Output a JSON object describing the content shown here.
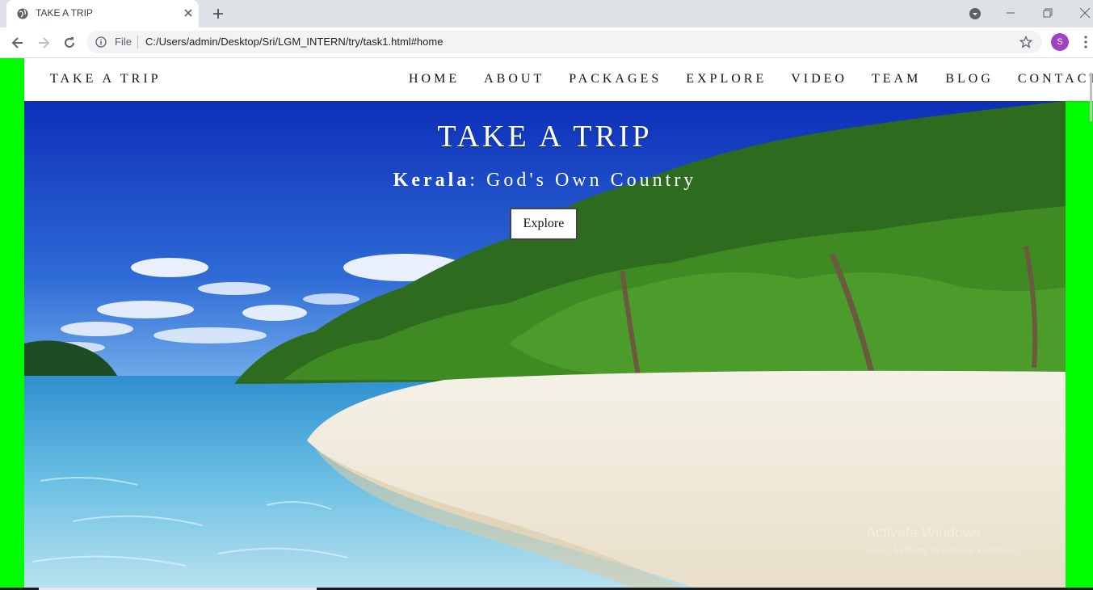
{
  "browser": {
    "tab_title": "TAKE A TRIP",
    "file_label": "File",
    "url": "C:/Users/admin/Desktop/Sri/LGM_INTERN/try/task1.html#home",
    "profile_initial": "S"
  },
  "site": {
    "brand": "TAKE A TRIP",
    "menu": [
      "HOME",
      "ABOUT",
      "PACKAGES",
      "EXPLORE",
      "VIDEO",
      "TEAM",
      "BLOG",
      "CONTACT"
    ]
  },
  "hero": {
    "title": "TAKE A TRIP",
    "subtitle_bold": "Kerala",
    "subtitle_rest": ": God's Own Country",
    "button_label": "Explore"
  },
  "watermark": {
    "line1": "Activate Windows",
    "line2": "Go to Settings to activate Windows."
  },
  "colors": {
    "page_side_bg": "#00ff00",
    "nav_bg": "#ffffff",
    "sky": "#1b47c9",
    "sand": "#f1ece1",
    "water": "#5fb8dd"
  }
}
